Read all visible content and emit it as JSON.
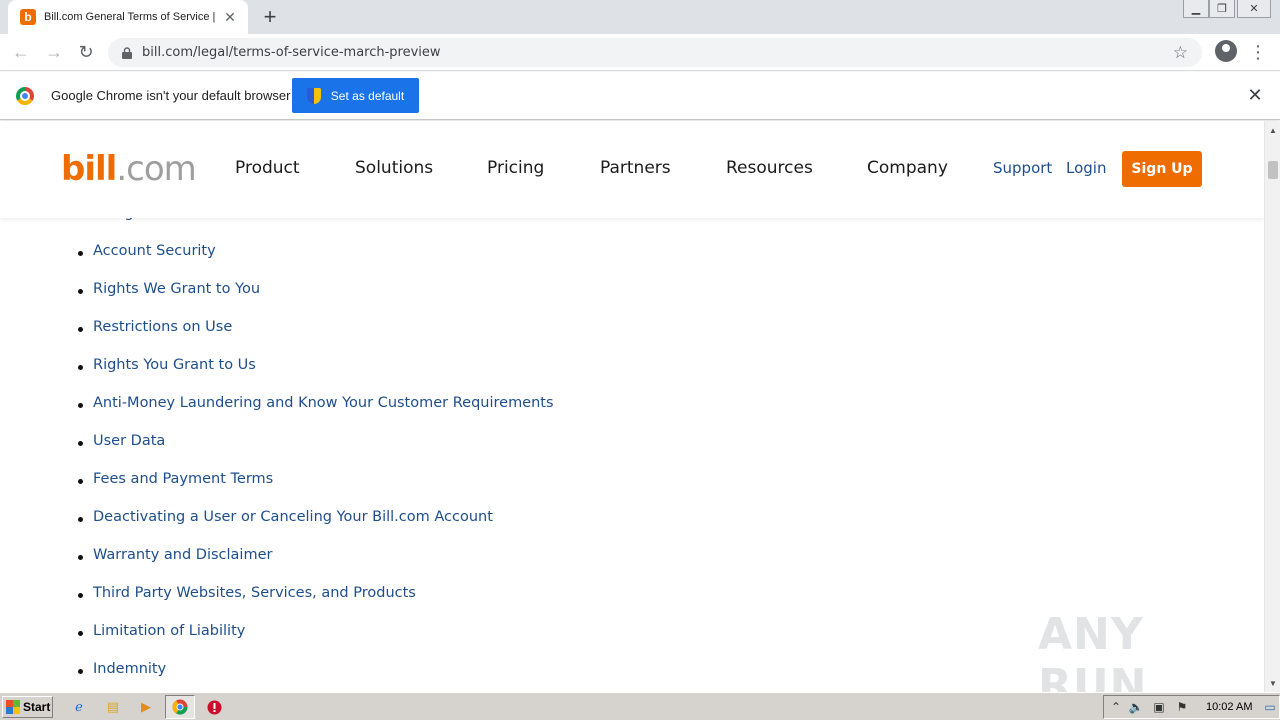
{
  "browser": {
    "tab_title": "Bill.com General Terms of Service | Bill.com",
    "tab_favicon": "b",
    "url": "bill.com/legal/terms-of-service-march-preview"
  },
  "infobar": {
    "message": "Google Chrome isn't your default browser",
    "button": "Set as default"
  },
  "site": {
    "logo_bold": "bill",
    "logo_light": ".com",
    "nav": [
      "Product",
      "Solutions",
      "Pricing",
      "Partners",
      "Resources",
      "Company"
    ],
    "support": "Support",
    "login": "Login",
    "signup": "Sign Up",
    "brand_color": "#ef6c00",
    "link_color": "#1f4e8c"
  },
  "toc": [
    "Using the Bill.com Service",
    "Account Security",
    "Rights We Grant to You",
    "Restrictions on Use",
    "Rights You Grant to Us",
    "Anti-Money Laundering and Know Your Customer Requirements",
    "User Data",
    "Fees and Payment Terms",
    "Deactivating a User or Canceling Your Bill.com Account",
    "Warranty and Disclaimer",
    "Third Party Websites, Services, and Products",
    "Limitation of Liability",
    "Indemnity"
  ],
  "watermark": "ANY RUN",
  "taskbar": {
    "start": "Start",
    "clock": "10:02 AM"
  }
}
